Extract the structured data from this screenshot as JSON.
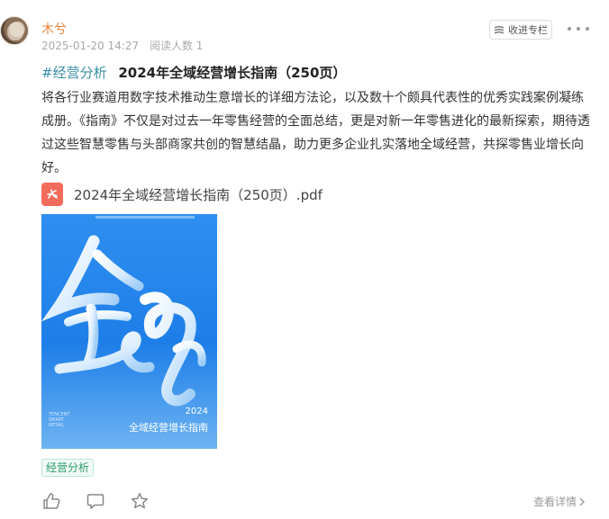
{
  "post": {
    "author": "木兮",
    "date": "2025-01-20 14:27",
    "read_count": "阅读人数 1",
    "collect_label": "收进专栏",
    "hashtag": "#经营分析",
    "title": "2024年全域经营增长指南（250页）",
    "body": "将各行业赛道用数字技术推动生意增长的详细方法论，以及数十个颇具代表性的优秀实践案例凝练成册。《指南》不仅是对过去一年零售经营的全面总结，更是对新一年零售进化的最新探索，期待透过这些智慧零售与头部商家共创的智慧结晶，助力更多企业扎实落地全域经营，共探零售业增长向好。",
    "attachment_name": "2024年全域经营增长指南（250页）.pdf",
    "cover": {
      "year": "2024",
      "title": "全域经营增长指南",
      "brand": "TENCENT SMART RETAIL"
    },
    "tag": "经营分析",
    "view_detail": "查看详情"
  },
  "icons": {
    "collect": "bookmark-icon",
    "more": "more-dots-icon",
    "pdf": "pdf-file-icon",
    "like": "thumb-up-icon",
    "comment": "comment-icon",
    "favorite": "star-icon",
    "chevron": "chevron-right-icon"
  },
  "colors": {
    "author": "#e8833a",
    "hashtag": "#3b8ea5",
    "tag": "#2a9b6f",
    "pdf": "#f26b5b",
    "cover": "#1d7ee8"
  }
}
